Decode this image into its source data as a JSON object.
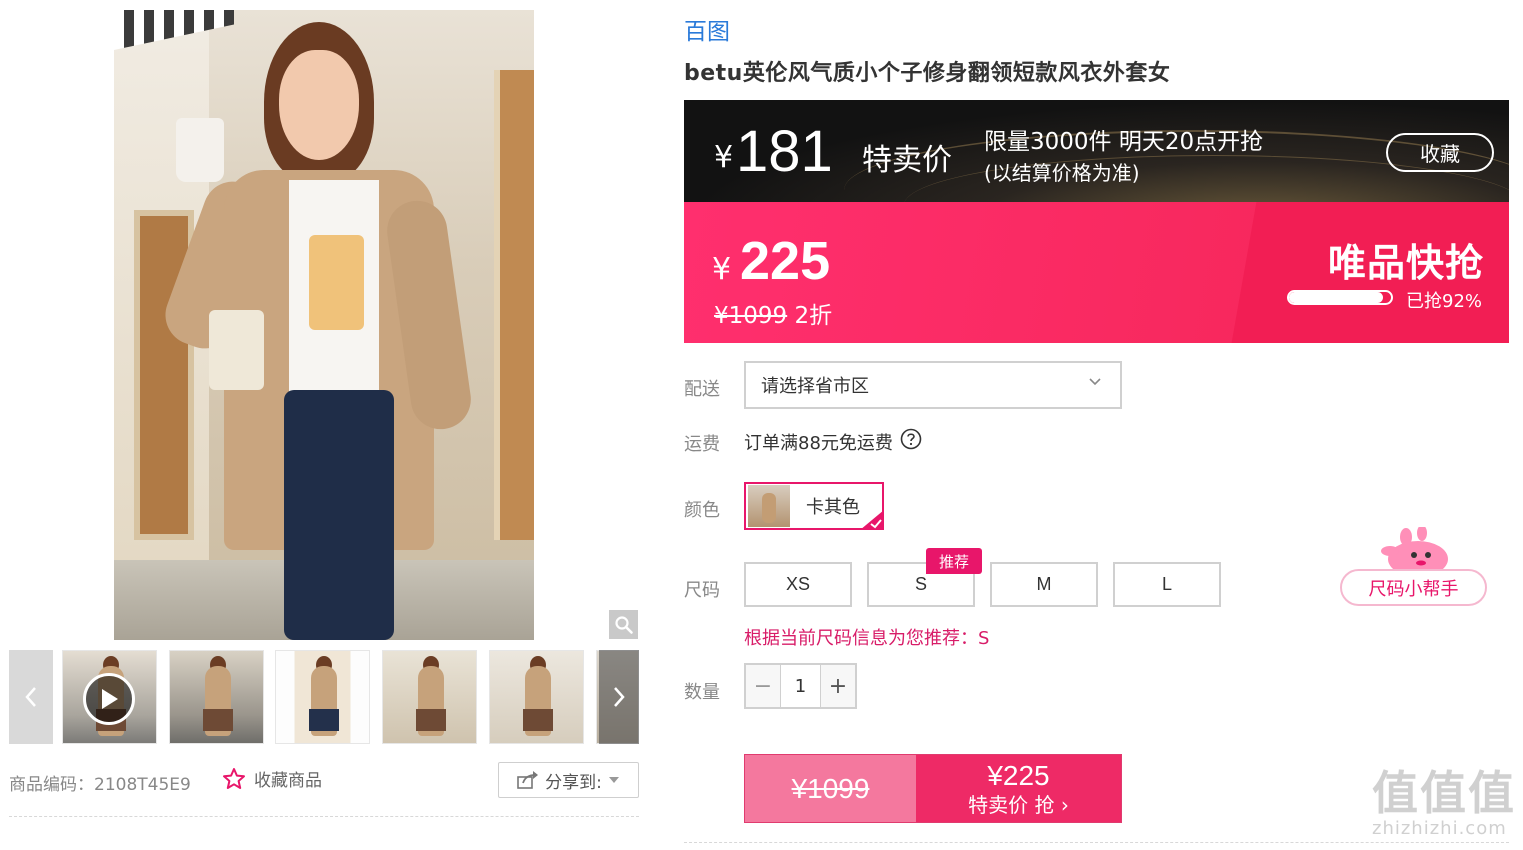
{
  "gallery": {
    "thumbnails": [
      "video",
      "photo-2",
      "photo-3",
      "photo-4",
      "photo-5",
      "photo-6"
    ],
    "sku_text": "商品编码：2108T45E9",
    "favorite_label": "收藏商品",
    "share_label": "分享到:"
  },
  "product": {
    "brand": "百图",
    "title": "betu英伦风气质小个子修身翻领短款风衣外套女"
  },
  "flash_sale": {
    "currency": "¥",
    "price": "181",
    "label": "特卖价",
    "limit_text": "限量3000件 明天20点开抢",
    "note": "(以结算价格为准)",
    "collect_label": "收藏"
  },
  "vip_sale": {
    "currency": "¥",
    "price": "225",
    "original_price": "¥1099",
    "discount": "2折",
    "logo_text": "唯品快抢",
    "progress_percent": 92,
    "progress_text": "已抢92%"
  },
  "delivery": {
    "label": "配送",
    "placeholder": "请选择省市区"
  },
  "shipping": {
    "label": "运费",
    "text": "订单满88元免运费"
  },
  "color": {
    "label": "颜色",
    "selected": "卡其色"
  },
  "size": {
    "label": "尺码",
    "options": [
      "XS",
      "S",
      "M",
      "L"
    ],
    "recommended_tag": "推荐",
    "recommendation_text": "根据当前尺码信息为您推荐：S",
    "helper_label": "尺码小帮手"
  },
  "quantity": {
    "label": "数量",
    "value": "1",
    "minus": "−",
    "plus": "+"
  },
  "buy": {
    "original_price": "¥1099",
    "price": "¥225",
    "label": "特卖价 抢"
  },
  "watermark": {
    "big": "值值值",
    "small": "zhizhizhi.com"
  },
  "colors": {
    "brand_pink": "#ee2a66",
    "link_blue": "#2a7ad9",
    "vip_bar": "#f7285d"
  }
}
